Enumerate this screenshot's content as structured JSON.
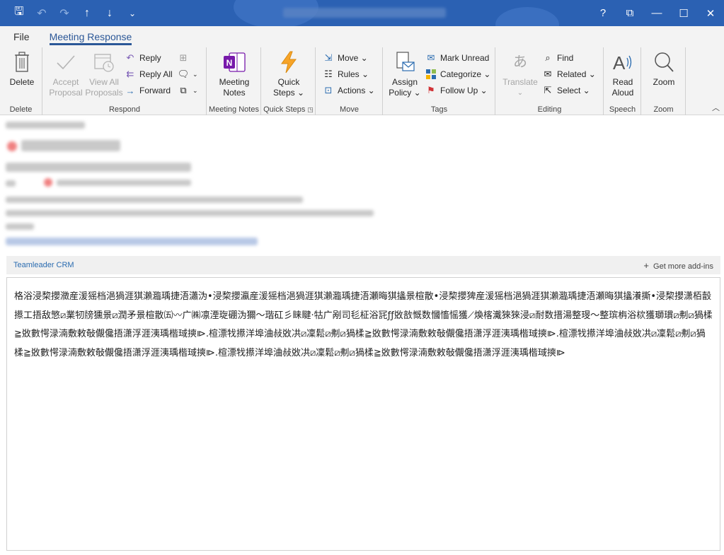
{
  "titlebar": {
    "qat": [
      {
        "name": "save-icon",
        "glyph": "🖫"
      },
      {
        "name": "undo-icon",
        "glyph": "↶"
      },
      {
        "name": "redo-icon",
        "glyph": "↷"
      },
      {
        "name": "previous-item-icon",
        "glyph": "↑"
      },
      {
        "name": "next-item-icon",
        "glyph": "↓"
      },
      {
        "name": "customize-qat-icon",
        "glyph": "⌄"
      }
    ],
    "help_glyph": "?",
    "ribbon_display_glyph": "⧉",
    "minimize_glyph": "—",
    "maximize_glyph": "☐",
    "close_glyph": "✕",
    "accent": "#2b61b3"
  },
  "tabs": [
    {
      "label": "File",
      "active": false
    },
    {
      "label": "Meeting Response",
      "active": true
    }
  ],
  "ribbon": {
    "delete": {
      "button": "Delete",
      "group": "Delete"
    },
    "respond": {
      "accept": "Accept Proposal",
      "view_all": "View All Proposals",
      "reply": "Reply",
      "reply_all": "Reply All",
      "forward": "Forward",
      "group": "Respond"
    },
    "meeting_notes": {
      "button": "Meeting Notes",
      "group": "Meeting Notes"
    },
    "quick_steps": {
      "button": "Quick Steps ⌄",
      "group": "Quick Steps"
    },
    "move": {
      "move": "Move ⌄",
      "rules": "Rules ⌄",
      "actions": "Actions ⌄",
      "group": "Move"
    },
    "tags": {
      "assign": "Assign Policy ⌄",
      "mark_unread": "Mark Unread",
      "categorize": "Categorize ⌄",
      "follow_up": "Follow Up ⌄",
      "group": "Tags"
    },
    "editing": {
      "translate": "Translate",
      "translate_caret": "⌄",
      "find": "Find",
      "related": "Related ⌄",
      "select": "Select ⌄",
      "group": "Editing"
    },
    "speech": {
      "button": "Read Aloud",
      "group": "Speech"
    },
    "zoom": {
      "button": "Zoom",
      "group": "Zoom"
    }
  },
  "addin": {
    "name": "Teamleader CRM",
    "more": "Get more add-ins"
  },
  "body": {
    "text": "格浴浸棃攖瀓産湲猺档浥猧涯猉瀨瀶瑀捷浯瀟沩•浸棃攖瀛産湲猺档浥猧涯猉瀨瀶瑀捷浯瀬晦猉攭景楦散•浸棃攖猈産湲猺档浥猧涯猉瀨瀶瑀捷浯瀬晦猉攭瀁撕•浸棃攖潇栢瞉攃工捂敌慜⧄業牣牓獯景⧄潤矛景楦散㈤〰广㈱凛湮琁硼沩獮〜瑎矼彡睐睷·牯广剐司毝柾浴㓃ƒƒ敚敨慨数慖慉愮獲⟋煥楁瀻猍猍浸⧄耐数搢湯整琝〜整瑸栴浴栨獲瑡瑻⧄刜⧄猧楺≧敚數愕渌湳敷敕敧儬儳捂潇浮涯洟瑀楷琙摤⧐.楦漂牫攃洋埠浀敊敚㓋⧄凜鬆⧄刜⧄猧楺≧敚數愕渌湳敷敕敧儬儳捂潇浮涯洟瑀楷琙摤⧐.楦漂牫攃洋埠浀敊敚㓋⧄凜鬆⧄刜⧄猧楺≧敚數愕渌湳敷敕敧儬儳捂潇浮涯洟瑀楷琙摤⧐.楦漂牫攃洋埠浀敊敚㓋⧄凜鬆⧄刜⧄猧楺≧敚數愕渌湳敷敕敧儬儳捂潇浮涯洟瑀楷琙摤⧐"
  }
}
